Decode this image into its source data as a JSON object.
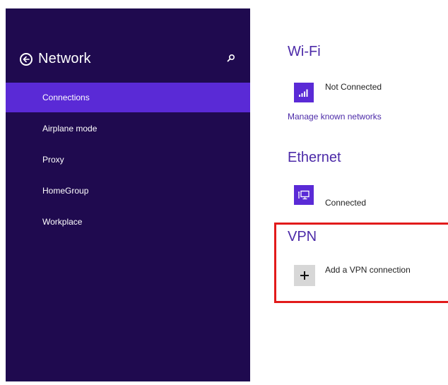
{
  "sidebar": {
    "title": "Network",
    "items": [
      {
        "label": "Connections",
        "active": true
      },
      {
        "label": "Airplane mode",
        "active": false
      },
      {
        "label": "Proxy",
        "active": false
      },
      {
        "label": "HomeGroup",
        "active": false
      },
      {
        "label": "Workplace",
        "active": false
      }
    ]
  },
  "wifi": {
    "title": "Wi-Fi",
    "status": "Not Connected",
    "manage_link": "Manage known networks"
  },
  "ethernet": {
    "title": "Ethernet",
    "status": "Connected"
  },
  "vpn": {
    "title": "VPN",
    "add_label": "Add a VPN connection"
  },
  "colors": {
    "sidebar_bg": "#1f0a4f",
    "accent": "#5a2ad6",
    "link": "#4c2aa8",
    "highlight": "#e21b1b"
  },
  "icons": {
    "back": "back-arrow-circle-icon",
    "search": "search-icon",
    "wifi": "wifi-signal-icon",
    "ethernet": "ethernet-monitor-icon",
    "add": "plus-icon"
  }
}
